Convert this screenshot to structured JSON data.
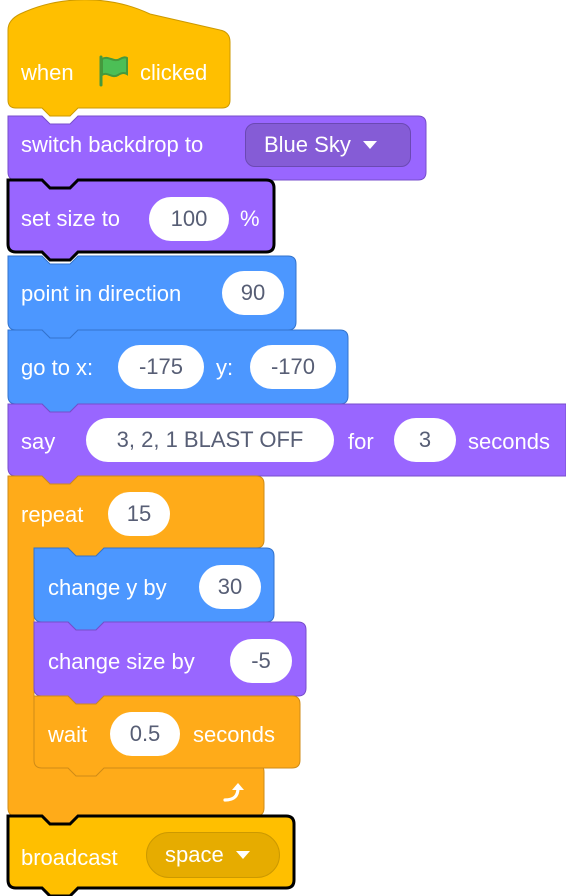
{
  "script": {
    "hat": {
      "prefix": "when",
      "suffix": "clicked",
      "icon": "green-flag-icon"
    },
    "switch_backdrop": {
      "label": "switch backdrop to",
      "value": "Blue Sky"
    },
    "set_size": {
      "label": "set size to",
      "value": "100",
      "unit": "%"
    },
    "point_direction": {
      "label": "point in direction",
      "value": "90"
    },
    "goto_xy": {
      "label": "go to x:",
      "x": "-175",
      "y_label": "y:",
      "y": "-170"
    },
    "say_for": {
      "label": "say",
      "message": "3, 2, 1 BLAST OFF",
      "for_label": "for",
      "secs": "3",
      "secs_label": "seconds"
    },
    "repeat": {
      "label": "repeat",
      "count": "15",
      "loop_icon": "repeat-arrow-icon"
    },
    "change_y": {
      "label": "change y by",
      "value": "30"
    },
    "change_size": {
      "label": "change size by",
      "value": "-5"
    },
    "wait": {
      "label": "wait",
      "value": "0.5",
      "unit": "seconds"
    },
    "broadcast": {
      "label": "broadcast",
      "value": "space"
    }
  },
  "colors": {
    "events": "#ffbf00",
    "events_border": "#cc9900",
    "looks": "#9966ff",
    "looks_border": "#774dcb",
    "motion": "#4c97ff",
    "motion_border": "#3373cc",
    "control": "#ffab19",
    "control_border": "#cf8b17",
    "flag": "#4cbf56",
    "selected_outline": "#000000",
    "input_text": "#575e75"
  }
}
